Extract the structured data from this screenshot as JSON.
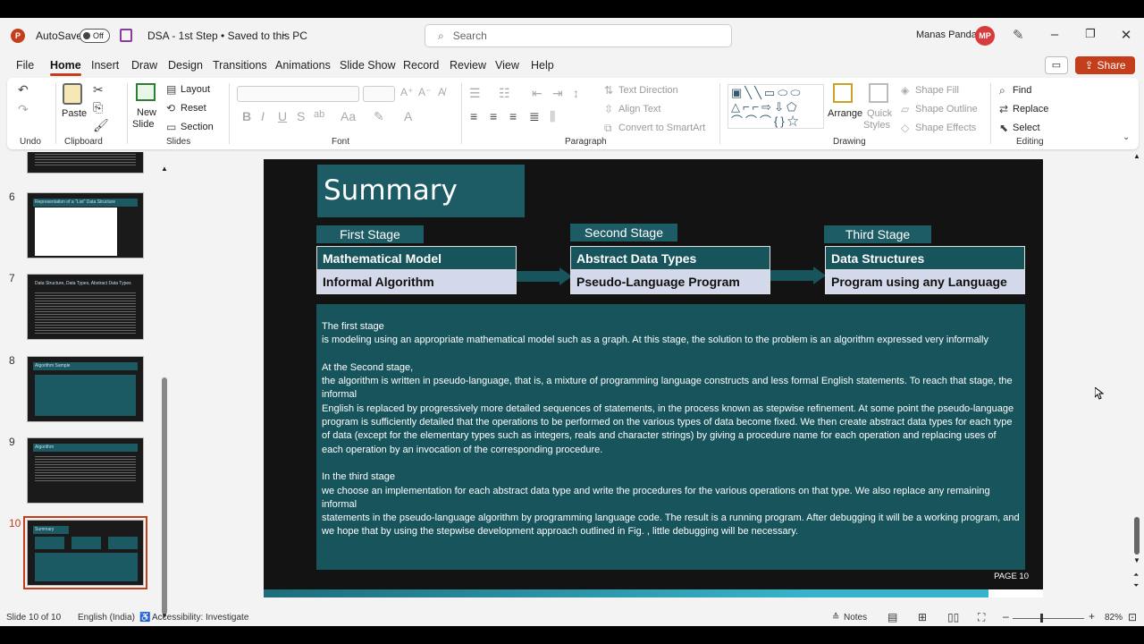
{
  "titlebar": {
    "autosave_label": "AutoSave",
    "autosave_state": "Off",
    "doc_title": "DSA - 1st Step • Saved to this PC",
    "search_placeholder": "Search",
    "user_name": "Manas Panda",
    "user_initials": "MP"
  },
  "menu": {
    "tabs": [
      "File",
      "Home",
      "Insert",
      "Draw",
      "Design",
      "Transitions",
      "Animations",
      "Slide Show",
      "Record",
      "Review",
      "View",
      "Help"
    ],
    "share_label": "Share"
  },
  "ribbon": {
    "undo_group": "Undo",
    "paste_label": "Paste",
    "clipboard_group": "Clipboard",
    "new_slide_label1": "New",
    "new_slide_label2": "Slide",
    "layout_label": "Layout",
    "reset_label": "Reset",
    "section_label": "Section",
    "slides_group": "Slides",
    "font_group": "Font",
    "text_direction": "Text Direction",
    "align_text": "Align Text",
    "convert_smartart": "Convert to SmartArt",
    "paragraph_group": "Paragraph",
    "arrange_label": "Arrange",
    "quick_styles_label1": "Quick",
    "quick_styles_label2": "Styles",
    "shape_fill": "Shape Fill",
    "shape_outline": "Shape Outline",
    "shape_effects": "Shape Effects",
    "drawing_group": "Drawing",
    "find_label": "Find",
    "replace_label": "Replace",
    "select_label": "Select",
    "editing_group": "Editing"
  },
  "thumbnails": [
    {
      "num": "6",
      "title": "Representation of a \"List\" Data Structure"
    },
    {
      "num": "7",
      "title": "Data Structure, Data Types, Abstract Data Types"
    },
    {
      "num": "8",
      "title": "Algorithm Sample"
    },
    {
      "num": "9",
      "title": "Algorithm"
    },
    {
      "num": "10",
      "title": "Summary"
    }
  ],
  "slide": {
    "title": "Summary",
    "stages": [
      {
        "label": "First Stage",
        "top": "Mathematical Model",
        "bottom": "Informal Algorithm"
      },
      {
        "label": "Second Stage",
        "top": "Abstract Data Types",
        "bottom": "Pseudo-Language Program"
      },
      {
        "label": "Third Stage",
        "top": "Data Structures",
        "bottom": "Program using any Language"
      }
    ],
    "body": {
      "p1_head": "The first stage",
      "p1_text": "is modeling using an appropriate mathematical model such as a graph. At this stage, the  solution to the problem is an algorithm expressed very informally",
      "p2_head": "At the Second stage,",
      "p2_text1": "the algorithm is written in pseudo-language, that is, a mixture of programming language constructs and less formal English statements. To reach that stage, the informal",
      "p2_text2": "English is replaced by progressively more detailed sequences of statements, in the process known as stepwise refinement. At some point the pseudo-language program is sufficiently  detailed that the operations to be performed on the various types of data become fixed. We then create  abstract data types for each type of data (except for the elementary types such as integers, reals and character strings) by giving a procedure name for each operation and replacing uses of each operation by an invocation of the corresponding procedure.",
      "p3_head": "In the third stage",
      "p3_text1": "we choose an implementation for each abstract data type and write the  procedures for the various operations on that type. We also replace any remaining informal",
      "p3_text2": "statements in the pseudo-language algorithm by programming language code. The result is a running  program. After debugging it will be a working program, and we hope that by using the  stepwise development approach outlined in Fig. , little debugging will be necessary."
    },
    "page_label": "PAGE 10"
  },
  "status": {
    "slide_info": "Slide 10 of 10",
    "language": "English (India)",
    "accessibility": "Accessibility: Investigate",
    "notes_label": "Notes",
    "zoom": "82%"
  },
  "colors": {
    "accent": "#c43e1c",
    "slide_teal": "#17545c",
    "stage_light": "#d3d8ea"
  }
}
